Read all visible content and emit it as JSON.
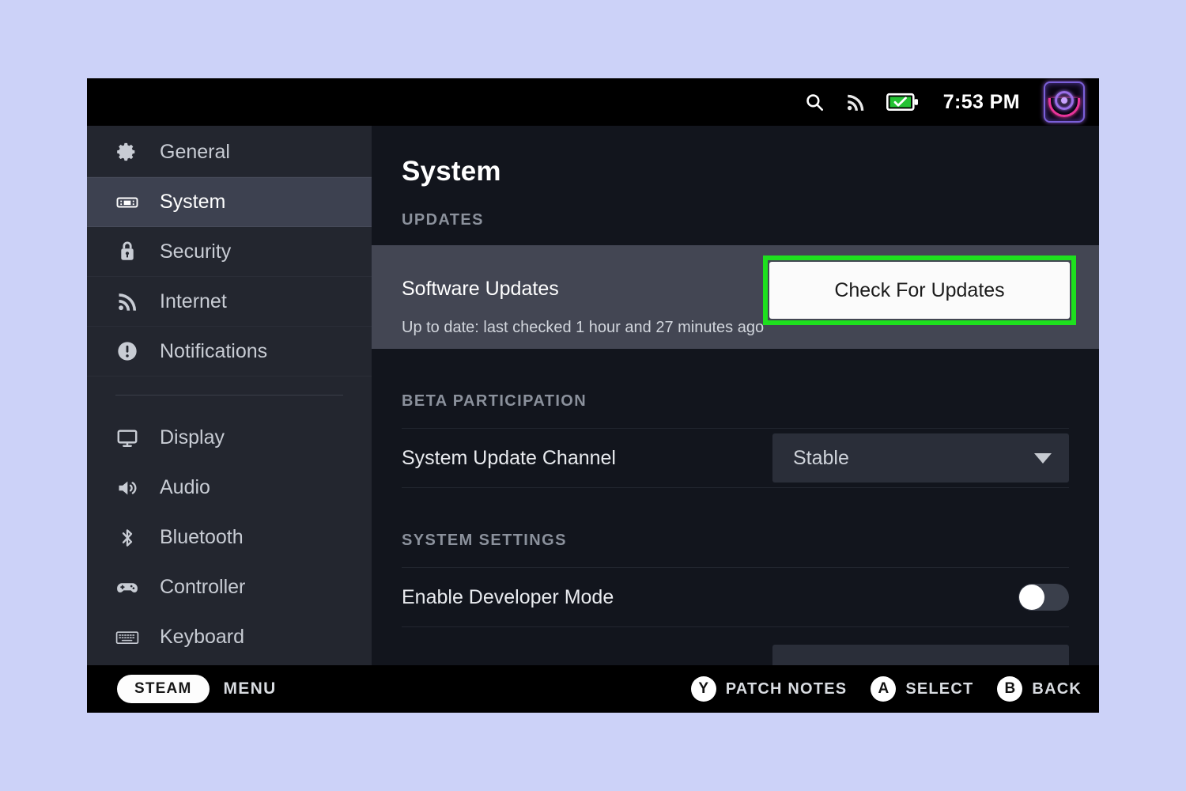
{
  "statusbar": {
    "search_icon": "search-icon",
    "wifi_icon": "wifi-icon",
    "battery_icon": "battery-charged-icon",
    "time": "7:53 PM",
    "avatar": "user-avatar"
  },
  "sidebar": {
    "items": [
      {
        "label": "General",
        "icon": "gear-icon",
        "selected": false
      },
      {
        "label": "System",
        "icon": "handheld-icon",
        "selected": true
      },
      {
        "label": "Security",
        "icon": "lock-icon",
        "selected": false
      },
      {
        "label": "Internet",
        "icon": "wifi-icon",
        "selected": false
      },
      {
        "label": "Notifications",
        "icon": "alert-circle-icon",
        "selected": false
      },
      {
        "label": "Display",
        "icon": "monitor-icon",
        "selected": false
      },
      {
        "label": "Audio",
        "icon": "speaker-icon",
        "selected": false
      },
      {
        "label": "Bluetooth",
        "icon": "bluetooth-icon",
        "selected": false
      },
      {
        "label": "Controller",
        "icon": "gamepad-icon",
        "selected": false
      },
      {
        "label": "Keyboard",
        "icon": "keyboard-icon",
        "selected": false
      }
    ]
  },
  "main": {
    "title": "System",
    "sections": {
      "updates": {
        "heading": "UPDATES",
        "row_label": "Software Updates",
        "row_status": "Up to date: last checked 1 hour and 27 minutes ago",
        "button_label": "Check For Updates",
        "highlight_color": "#1ee01e"
      },
      "beta": {
        "heading": "BETA PARTICIPATION",
        "row_label": "System Update Channel",
        "selected_value": "Stable"
      },
      "system_settings": {
        "heading": "SYSTEM SETTINGS",
        "row_label": "Enable Developer Mode",
        "toggle_state": "off"
      }
    }
  },
  "bottombar": {
    "steam_label": "STEAM",
    "menu_label": "MENU",
    "hints": [
      {
        "button": "Y",
        "label": "PATCH NOTES"
      },
      {
        "button": "A",
        "label": "SELECT"
      },
      {
        "button": "B",
        "label": "BACK"
      }
    ]
  }
}
